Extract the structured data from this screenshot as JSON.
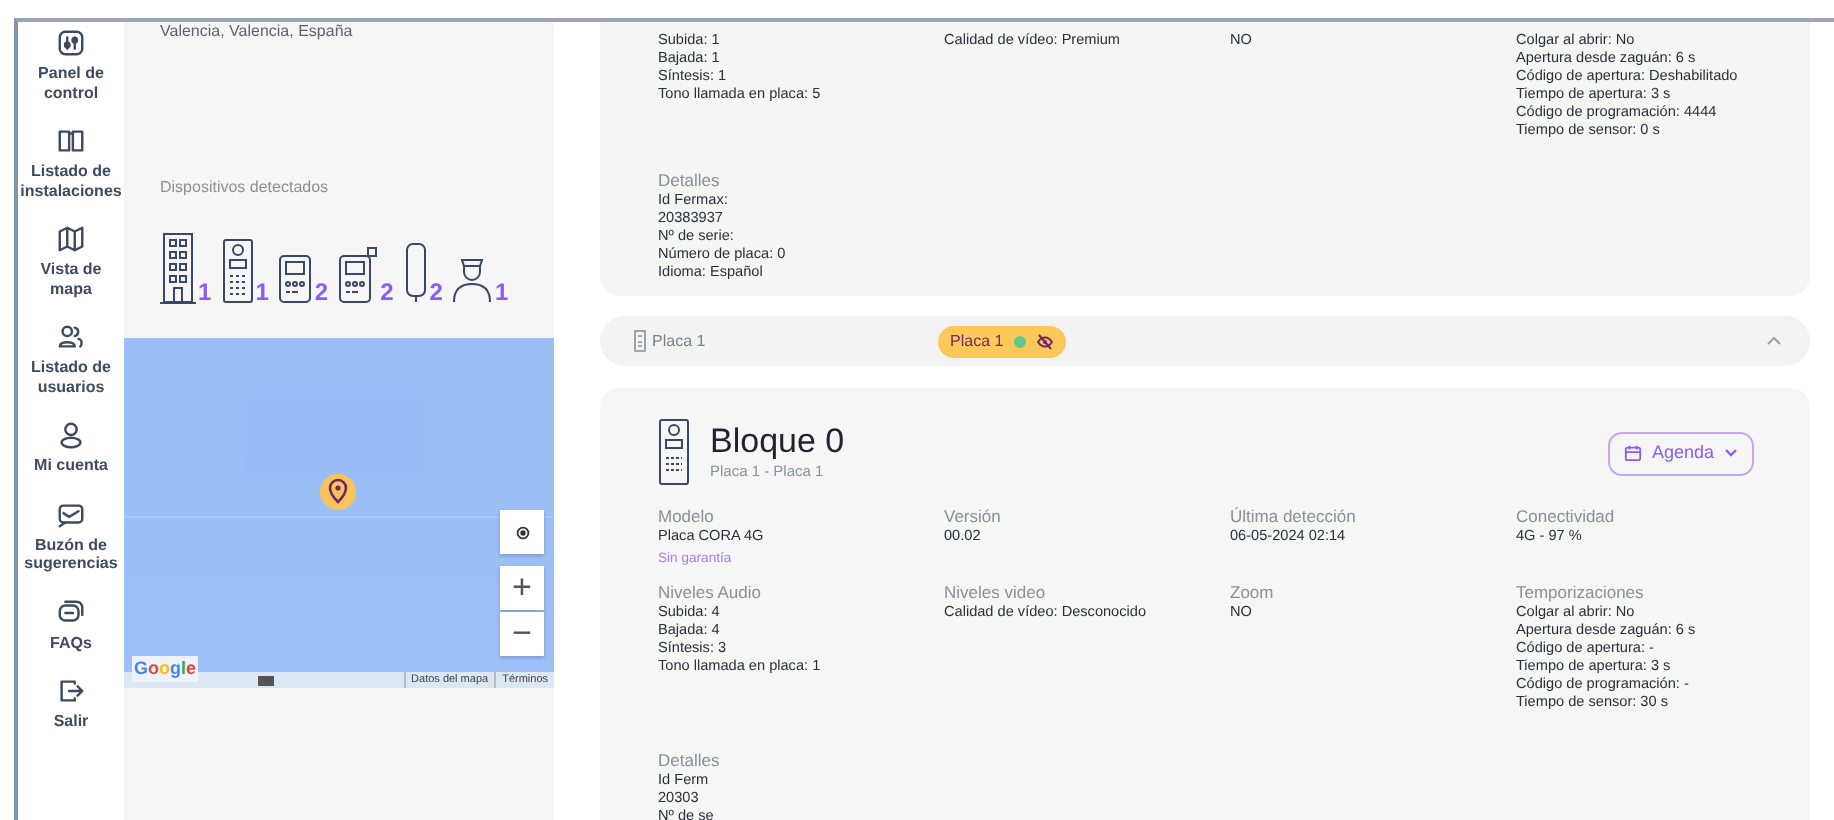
{
  "sidebar": {
    "items": [
      {
        "kind": "panel",
        "label": "Panel de control"
      },
      {
        "kind": "book",
        "label": "Listado de instalaciones"
      },
      {
        "kind": "map",
        "label": "Vista de mapa"
      },
      {
        "kind": "users",
        "label": "Listado de usuarios"
      },
      {
        "kind": "user",
        "label": "Mi cuenta"
      },
      {
        "kind": "mailbox",
        "label": "Buzón de sugerencias"
      },
      {
        "kind": "faq",
        "label": "FAQs"
      },
      {
        "kind": "logout",
        "label": "Salir"
      }
    ]
  },
  "installation": {
    "address": "Valencia, Valencia, España",
    "devices_heading": "Dispositivos detectados",
    "devices": [
      {
        "kind": "building",
        "count": "1"
      },
      {
        "kind": "panel",
        "count": "1"
      },
      {
        "kind": "monitor",
        "count": "2"
      },
      {
        "kind": "monitor_plus",
        "count": "2"
      },
      {
        "kind": "handset",
        "count": "2"
      },
      {
        "kind": "concierge",
        "count": "1"
      }
    ]
  },
  "map": {
    "logo": "Google",
    "attribution": [
      "Datos del mapa",
      "Términos"
    ],
    "zoom_in": "+",
    "zoom_out": "−"
  },
  "previous_card": {
    "columns": [
      [
        "Subida: 1",
        "Bajada: 1",
        "Síntesis: 1",
        "Tono llamada en placa: 5"
      ],
      [
        "Calidad de vídeo: Premium"
      ],
      [
        "NO"
      ],
      [
        "Colgar al abrir: No",
        "Apertura desde zaguán: 6 s",
        "Código de apertura: Deshabilitado",
        "Tiempo de apertura: 3 s",
        "Código de programación: 4444",
        "Tiempo de sensor: 0 s"
      ]
    ],
    "details": {
      "heading": "Detalles",
      "lines": [
        "Id Fermax:",
        "20383937",
        "Nº de serie:",
        "Número de placa: 0",
        "Idioma: Español"
      ]
    }
  },
  "accordion": {
    "label": "Placa 1",
    "badge": "Placa 1",
    "online": true,
    "expanded": true
  },
  "card": {
    "title": "Bloque 0",
    "subtitle": "Placa 1 - Placa 1",
    "button": "Agenda",
    "fields": [
      {
        "label": "Modelo",
        "lines": [
          "Placa CORA 4G"
        ],
        "note": "Sin garantía"
      },
      {
        "label": "Versión",
        "lines": [
          "00.02"
        ]
      },
      {
        "label": "Última detección",
        "lines": [
          "06-05-2024 02:14"
        ]
      },
      {
        "label": "Conectividad",
        "lines": [
          "4G - 97 %"
        ]
      },
      {
        "label": "Niveles Audio",
        "lines": [
          "Subida: 4",
          "Bajada: 4",
          "Síntesis: 3",
          "Tono llamada en placa: 1"
        ]
      },
      {
        "label": "Niveles video",
        "lines": [
          "Calidad de vídeo: Desconocido"
        ]
      },
      {
        "label": "Zoom",
        "lines": [
          "NO"
        ]
      },
      {
        "label": "Temporizaciones",
        "lines": [
          "Colgar al abrir: No",
          "Apertura desde zaguán: 6 s",
          "Código de apertura: -",
          "Tiempo de apertura: 3 s",
          "Código de programación: -",
          "Tiempo de sensor: 30 s"
        ]
      }
    ],
    "details": {
      "heading": "Detalles",
      "lines": [
        "Id Ferm",
        "20303",
        "Nº de se"
      ]
    }
  }
}
